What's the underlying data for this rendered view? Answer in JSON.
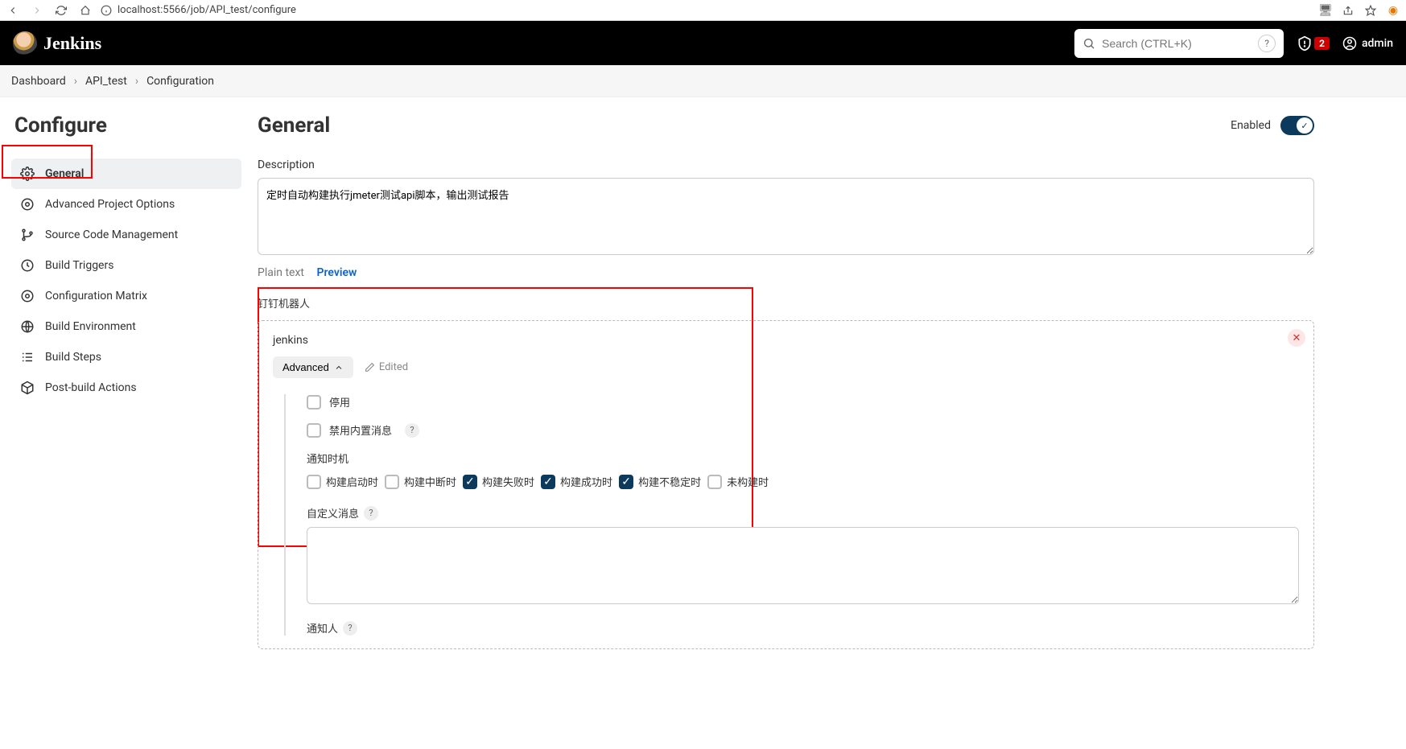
{
  "browser": {
    "url": "localhost:5566/job/API_test/configure"
  },
  "header": {
    "brand": "Jenkins",
    "search_placeholder": "Search (CTRL+K)",
    "alert_count": "2",
    "username": "admin"
  },
  "breadcrumb": {
    "items": [
      "Dashboard",
      "API_test",
      "Configuration"
    ]
  },
  "sidebar": {
    "title": "Configure",
    "items": [
      {
        "label": "General"
      },
      {
        "label": "Advanced Project Options"
      },
      {
        "label": "Source Code Management"
      },
      {
        "label": "Build Triggers"
      },
      {
        "label": "Configuration Matrix"
      },
      {
        "label": "Build Environment"
      },
      {
        "label": "Build Steps"
      },
      {
        "label": "Post-build Actions"
      }
    ]
  },
  "content": {
    "heading": "General",
    "enabled_label": "Enabled",
    "description_label": "Description",
    "description_value": "定时自动构建执行jmeter测试api脚本，输出测试报告",
    "plain_text": "Plain text",
    "preview": "Preview"
  },
  "robot": {
    "section_title": "钉钉机器人",
    "name": "jenkins",
    "advanced": "Advanced",
    "edited": "Edited",
    "disable_label": "停用",
    "disable_builtin_label": "禁用内置消息",
    "notify_timing_label": "通知时机",
    "timing_options": [
      {
        "label": "构建启动时",
        "checked": false
      },
      {
        "label": "构建中断时",
        "checked": false
      },
      {
        "label": "构建失败时",
        "checked": true
      },
      {
        "label": "构建成功时",
        "checked": true
      },
      {
        "label": "构建不稳定时",
        "checked": true
      },
      {
        "label": "未构建时",
        "checked": false
      }
    ],
    "custom_msg_label": "自定义消息",
    "notify_person_label": "通知人"
  }
}
